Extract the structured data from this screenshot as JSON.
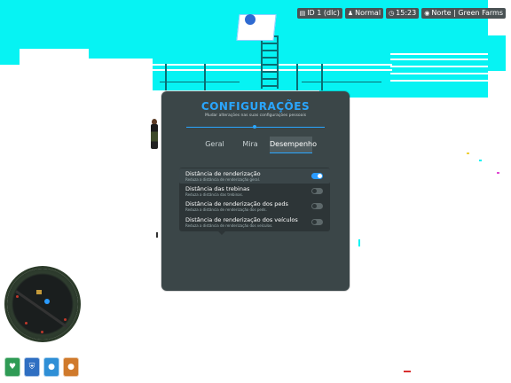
{
  "hud": {
    "chips": [
      {
        "icon": "id-card-icon",
        "glyph": "▤",
        "text": "ID 1 (dlc)"
      },
      {
        "icon": "person-icon",
        "glyph": "♟",
        "text": "Normal"
      },
      {
        "icon": "clock-icon",
        "glyph": "◷",
        "text": "15:23"
      },
      {
        "icon": "location-icon",
        "glyph": "◉",
        "text": "Norte | Green Farms"
      }
    ]
  },
  "settings": {
    "title": "CONFIGURAÇÕES",
    "subtitle": "Mudar alterações nas suas configurações pessoais",
    "tabs": [
      {
        "label": "Geral",
        "active": false
      },
      {
        "label": "Mira",
        "active": false
      },
      {
        "label": "Desempenho",
        "active": true
      }
    ],
    "options": [
      {
        "title": "Distância de renderização",
        "desc": "Reduza a distância de renderização geral.",
        "enabled": true
      },
      {
        "title": "Distância das trebinas",
        "desc": "Reduza a distância das trebinas.",
        "enabled": false
      },
      {
        "title": "Distância de renderização dos peds",
        "desc": "Reduza a distância de renderização dos peds.",
        "enabled": false
      },
      {
        "title": "Distância de renderização dos veículos",
        "desc": "Reduza a distância de renderização dos veículos.",
        "enabled": false
      }
    ],
    "accent_color": "#2aa6ff"
  },
  "status": [
    {
      "icon": "heart-icon",
      "glyph": "♥",
      "color": "#2f9b55"
    },
    {
      "icon": "shield-icon",
      "glyph": "⛨",
      "color": "#2f6fc2"
    },
    {
      "icon": "water-icon",
      "glyph": "●",
      "color": "#2f8fd6"
    },
    {
      "icon": "food-icon",
      "glyph": "●",
      "color": "#d07a2c"
    }
  ]
}
